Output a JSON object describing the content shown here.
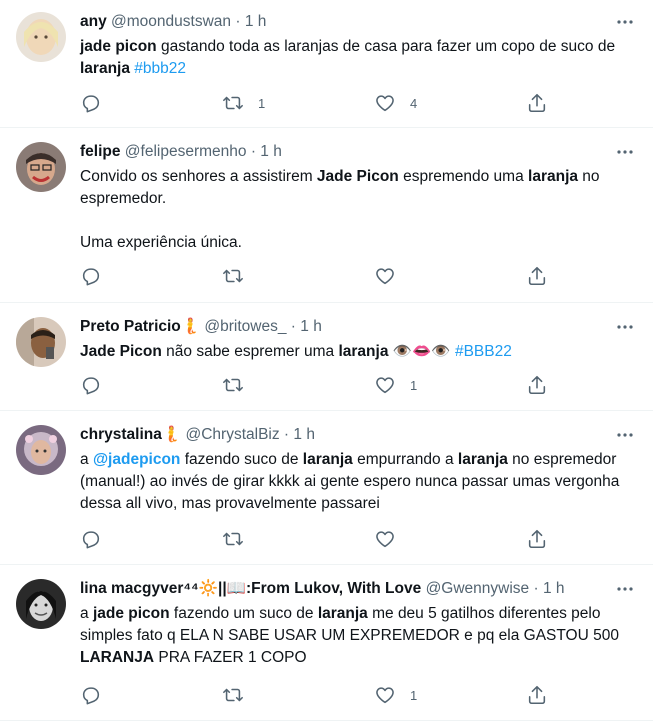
{
  "tweets": [
    {
      "name": "any",
      "handle": "@moondustswan",
      "time": "1 h",
      "text_html": "<b>jade picon</b> gastando toda as laranjas de casa para fazer um copo de suco de <b>laranja</b> <span class='tag'>#bbb22</span>",
      "replies": "",
      "retweets": "1",
      "likes": "4",
      "avatar_color": "#e8d7c3"
    },
    {
      "name": "felipe",
      "handle": "@felipesermenho",
      "time": "1 h",
      "text_html": "Convido os senhores a assistirem <b>Jade Picon</b> espremendo uma <b>laranja</b> no espremedor.<br><br>Uma experiência única.",
      "replies": "",
      "retweets": "",
      "likes": "",
      "avatar_color": "#6b5a55"
    },
    {
      "name": "Preto Patricio",
      "handle": "@britowes_",
      "time": "1 h",
      "text_html": "<b>Jade Picon</b> não sabe espremer uma <b>laranja</b> 👁️👄👁️ <span class='tag'>#BBB22</span>",
      "replies": "",
      "retweets": "",
      "likes": "1",
      "avatar_color": "#c9b8a8"
    },
    {
      "name": "chrystalina",
      "handle": "@ChrystalBiz",
      "time": "1 h",
      "text_html": "a <b class='mention'>@jadepicon</b> fazendo suco de <b>laranja</b> empurrando a <b>laranja</b> no espremedor (manual!) ao invés de girar kkkk ai gente espero nunca passar umas vergonha dessa all vivo, mas provavelmente passarei",
      "replies": "",
      "retweets": "",
      "likes": "",
      "avatar_color": "#9a8aa0"
    },
    {
      "name": "lina macgyver⁴⁴🔆||📖:From Lukov, With Love",
      "handle": "@Gwennywise",
      "time": "1 h",
      "text_html": "a <b>jade picon</b> fazendo um suco de <b>laranja</b> me deu 5 gatilhos diferentes pelo simples fato q ELA N SABE USAR UM EXPREMEDOR e pq ela GASTOU 500 <b>LARANJA</b> PRA FAZER 1 COPO",
      "replies": "",
      "retweets": "",
      "likes": "1",
      "avatar_color": "#3a3a3a"
    }
  ],
  "icons": {
    "reply": "reply-icon",
    "retweet": "retweet-icon",
    "like": "heart-icon",
    "share": "share-icon",
    "more": "more-icon"
  },
  "colors": {
    "accent": "#1d9bf0",
    "muted": "#536471",
    "text": "#0f1419",
    "divider": "#eff3f4"
  }
}
